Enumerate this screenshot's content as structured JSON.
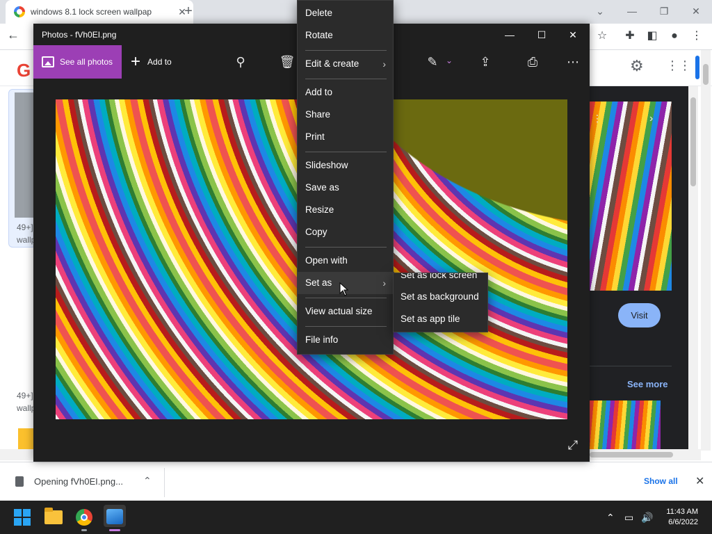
{
  "browser": {
    "tab_title": "windows 8.1 lock screen wallpap",
    "new_tab": "+",
    "window_controls": {
      "collapse": "⌄",
      "minimize": "—",
      "restore": "❐",
      "close": "✕"
    },
    "toolbar_icons": [
      "star-icon",
      "extensions-icon",
      "side-panel-icon",
      "profile-icon",
      "menu-icon"
    ]
  },
  "google_page": {
    "logo_letter": "G",
    "result_caption_1": "49+]",
    "result_caption_1b": "wallp",
    "result_caption_2": "49+]",
    "result_caption_2b": "wallp",
    "visit_label": "Visit",
    "see_more_label": "See more"
  },
  "download_bar": {
    "file_label": "Opening fVh0EI.png...",
    "show_all_label": "Show all"
  },
  "photos": {
    "title": "Photos - fVh0EI.png",
    "see_all_label": "See all photos",
    "add_to_label": "Add to",
    "window_controls": {
      "minimize": "—",
      "maximize": "☐",
      "close": "✕"
    },
    "accent_color": "#9c3fb5"
  },
  "context_menu": {
    "items": [
      {
        "label": "Delete"
      },
      {
        "label": "Rotate"
      },
      {
        "label": "Edit & create",
        "submenu": true
      },
      {
        "label": "Add to"
      },
      {
        "label": "Share"
      },
      {
        "label": "Print"
      },
      {
        "label": "Slideshow"
      },
      {
        "label": "Save as"
      },
      {
        "label": "Resize"
      },
      {
        "label": "Copy"
      },
      {
        "label": "Open with"
      },
      {
        "label": "Set as",
        "submenu": true,
        "highlighted": true
      },
      {
        "label": "View actual size"
      },
      {
        "label": "File info"
      }
    ],
    "set_as_submenu": [
      {
        "label": "Set as lock screen"
      },
      {
        "label": "Set as background"
      },
      {
        "label": "Set as app tile"
      }
    ]
  },
  "taskbar": {
    "time": "11:43 AM",
    "date": "6/6/2022"
  }
}
